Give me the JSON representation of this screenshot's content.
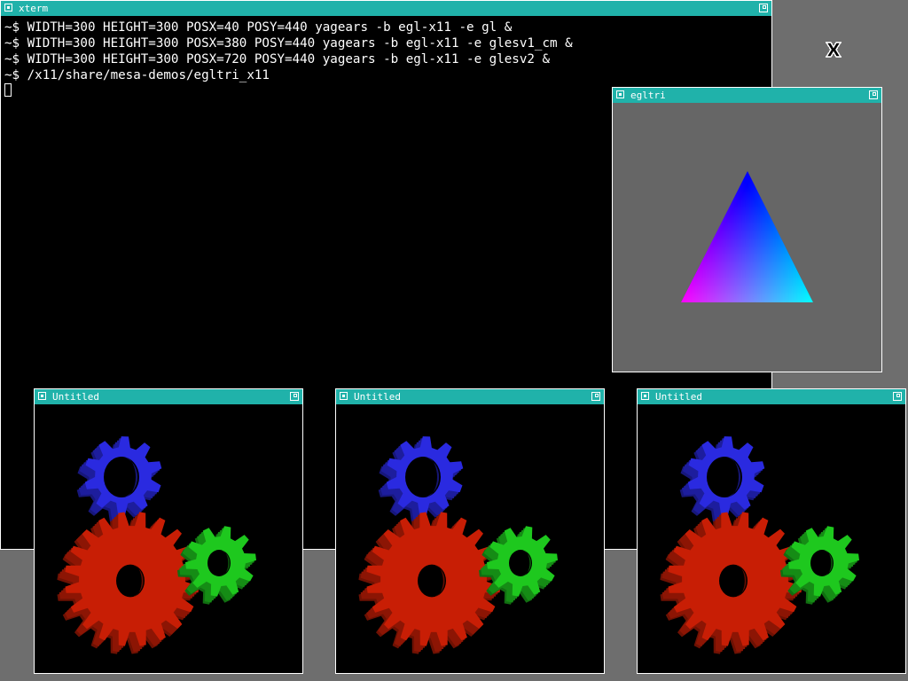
{
  "xterm": {
    "title": "xterm",
    "lines": [
      "~$ WIDTH=300 HEIGHT=300 POSX=40 POSY=440 yagears -b egl-x11 -e gl &",
      "~$ WIDTH=300 HEIGHT=300 POSX=380 POSY=440 yagears -b egl-x11 -e glesv1_cm &",
      "~$ WIDTH=300 HEIGHT=300 POSX=720 POSY=440 yagears -b egl-x11 -e glesv2 &",
      "~$ /x11/share/mesa-demos/egltri_x11"
    ]
  },
  "egltri": {
    "title": "egltri",
    "background": "#666666",
    "triangle_colors": {
      "top": "#0000ff",
      "bottom_left": "#ff0000",
      "bottom_right": "#00ff00"
    }
  },
  "gears_windows": [
    {
      "title": "Untitled"
    },
    {
      "title": "Untitled"
    },
    {
      "title": "Untitled"
    }
  ],
  "colors": {
    "titlebar": "#20b2aa",
    "gear_red": "#c81e05",
    "gear_green": "#1ec81e",
    "gear_blue": "#2a2ae0"
  },
  "icons": {
    "window_menu": "window-menu-icon",
    "maximize": "maximize-icon",
    "pointer": "x-cursor-icon"
  }
}
